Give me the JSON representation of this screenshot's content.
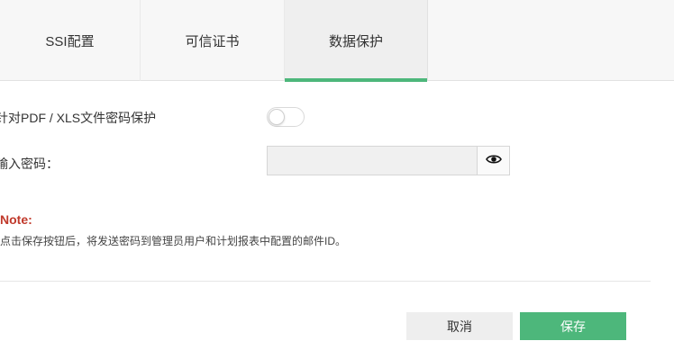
{
  "tabs": [
    {
      "label": "SSI配置"
    },
    {
      "label": "可信证书"
    },
    {
      "label": "数据保护"
    }
  ],
  "active_tab": "数据保护",
  "form": {
    "protect_label": "针对PDF / XLS文件密码保护",
    "protect_enabled": false,
    "password_label": "输入密码：",
    "password_value": "",
    "password_placeholder": ""
  },
  "note": {
    "title": "Note:",
    "text": "点击保存按钮后，将发送密码到管理员用户和计划报表中配置的邮件ID。"
  },
  "buttons": {
    "cancel": "取消",
    "save": "保存"
  },
  "icons": {
    "reveal": "eye-icon"
  },
  "colors": {
    "accent": "#4db77b",
    "note": "#c0392b"
  }
}
